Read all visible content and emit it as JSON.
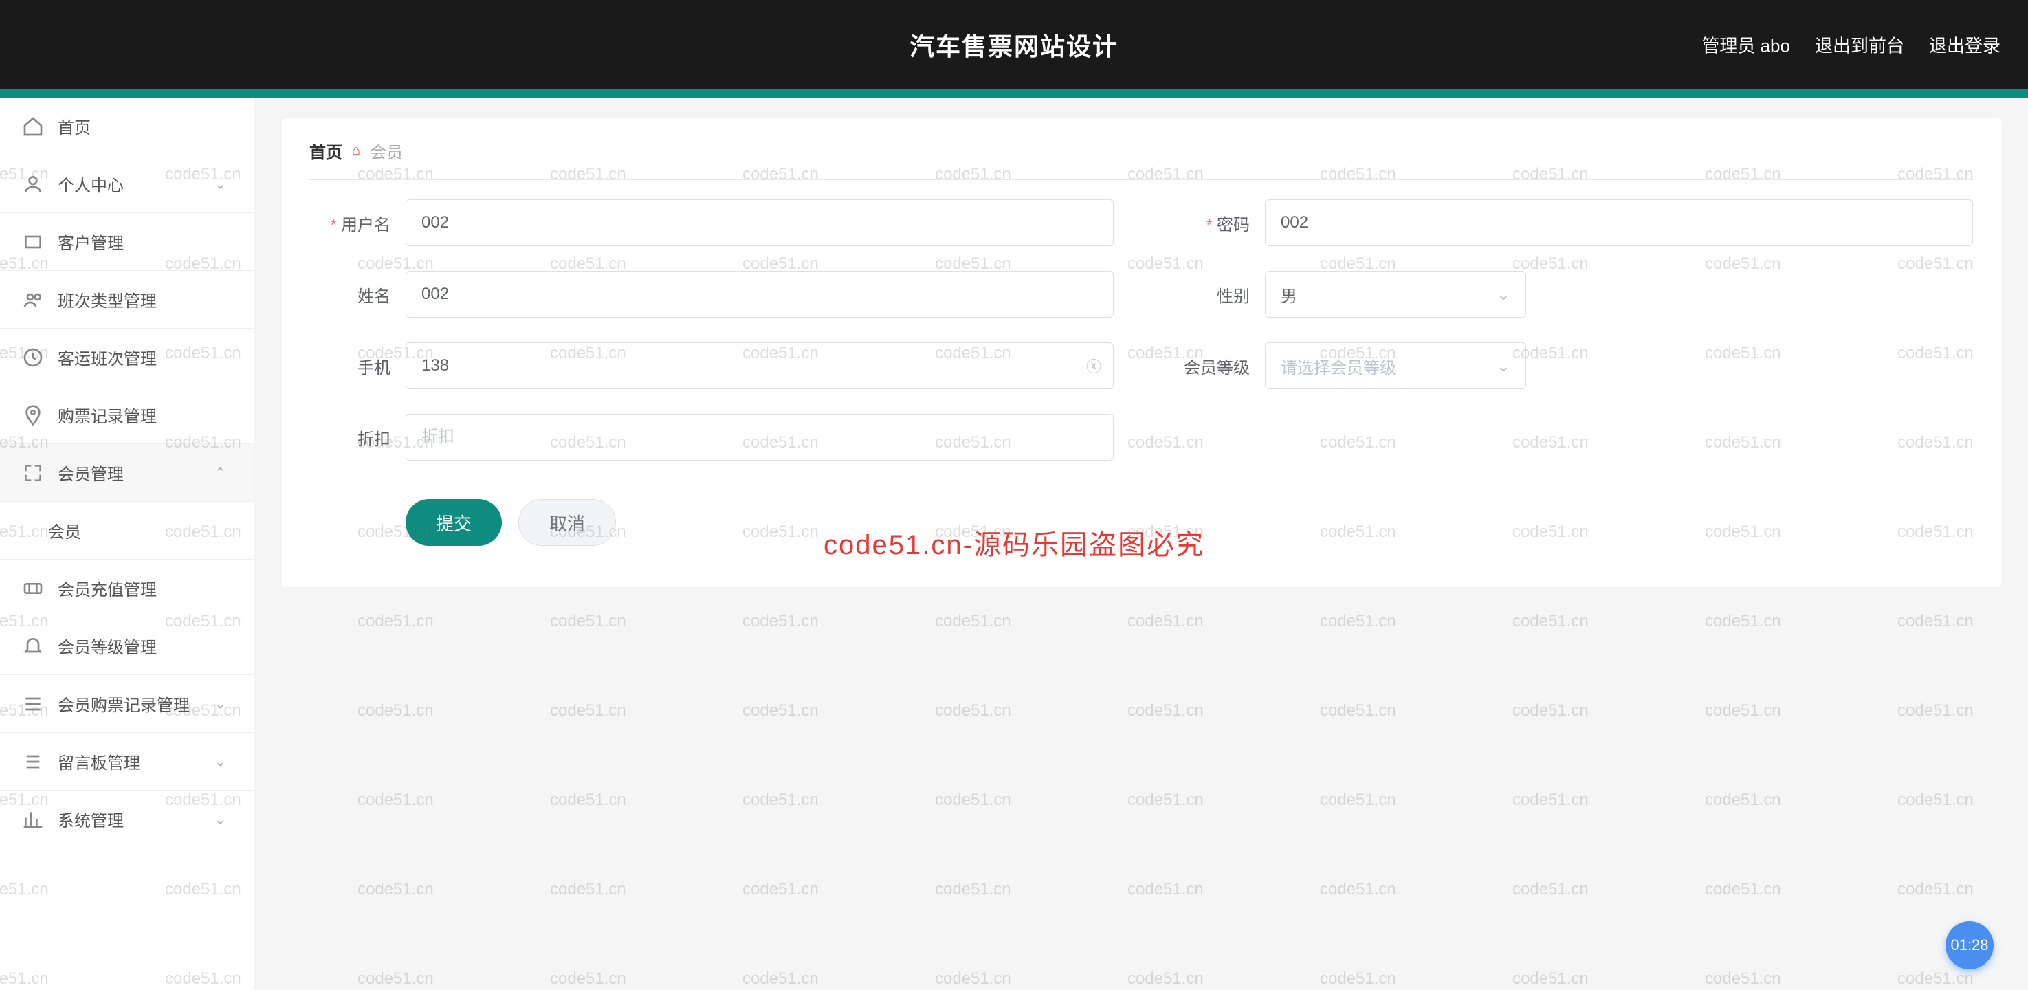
{
  "header": {
    "title": "汽车售票网站设计",
    "user_label": "管理员 abo",
    "front_label": "退出到前台",
    "logout_label": "退出登录"
  },
  "sidebar": {
    "items": [
      {
        "icon": "home",
        "label": "首页",
        "chevron": false
      },
      {
        "icon": "user",
        "label": "个人中心",
        "chevron": true
      },
      {
        "icon": "rect",
        "label": "客户管理",
        "chevron": false
      },
      {
        "icon": "users",
        "label": "班次类型管理",
        "chevron": false
      },
      {
        "icon": "clock",
        "label": "客运班次管理",
        "chevron": false
      },
      {
        "icon": "pin",
        "label": "购票记录管理",
        "chevron": false
      },
      {
        "icon": "expand",
        "label": "会员管理",
        "chevron": true,
        "expanded": true,
        "sub": "会员"
      },
      {
        "icon": "ticket",
        "label": "会员充值管理",
        "chevron": false
      },
      {
        "icon": "bell",
        "label": "会员等级管理",
        "chevron": false
      },
      {
        "icon": "list",
        "label": "会员购票记录管理",
        "chevron": true
      },
      {
        "icon": "list2",
        "label": "留言板管理",
        "chevron": true
      },
      {
        "icon": "chart",
        "label": "系统管理",
        "chevron": true
      }
    ]
  },
  "breadcrumb": {
    "home": "首页",
    "current": "会员"
  },
  "form": {
    "username": {
      "label": "用户名",
      "value": "002",
      "required": true
    },
    "password": {
      "label": "密码",
      "value": "002",
      "required": true
    },
    "name": {
      "label": "姓名",
      "value": "002"
    },
    "gender": {
      "label": "性别",
      "value": "男"
    },
    "phone": {
      "label": "手机",
      "value": "138"
    },
    "level": {
      "label": "会员等级",
      "placeholder": "请选择会员等级"
    },
    "discount": {
      "label": "折扣",
      "placeholder": "折扣"
    },
    "submit": "提交",
    "cancel": "取消"
  },
  "watermark": {
    "text": "code51.cn",
    "red": "code51.cn-源码乐园盗图必究"
  },
  "badge": "01:28"
}
